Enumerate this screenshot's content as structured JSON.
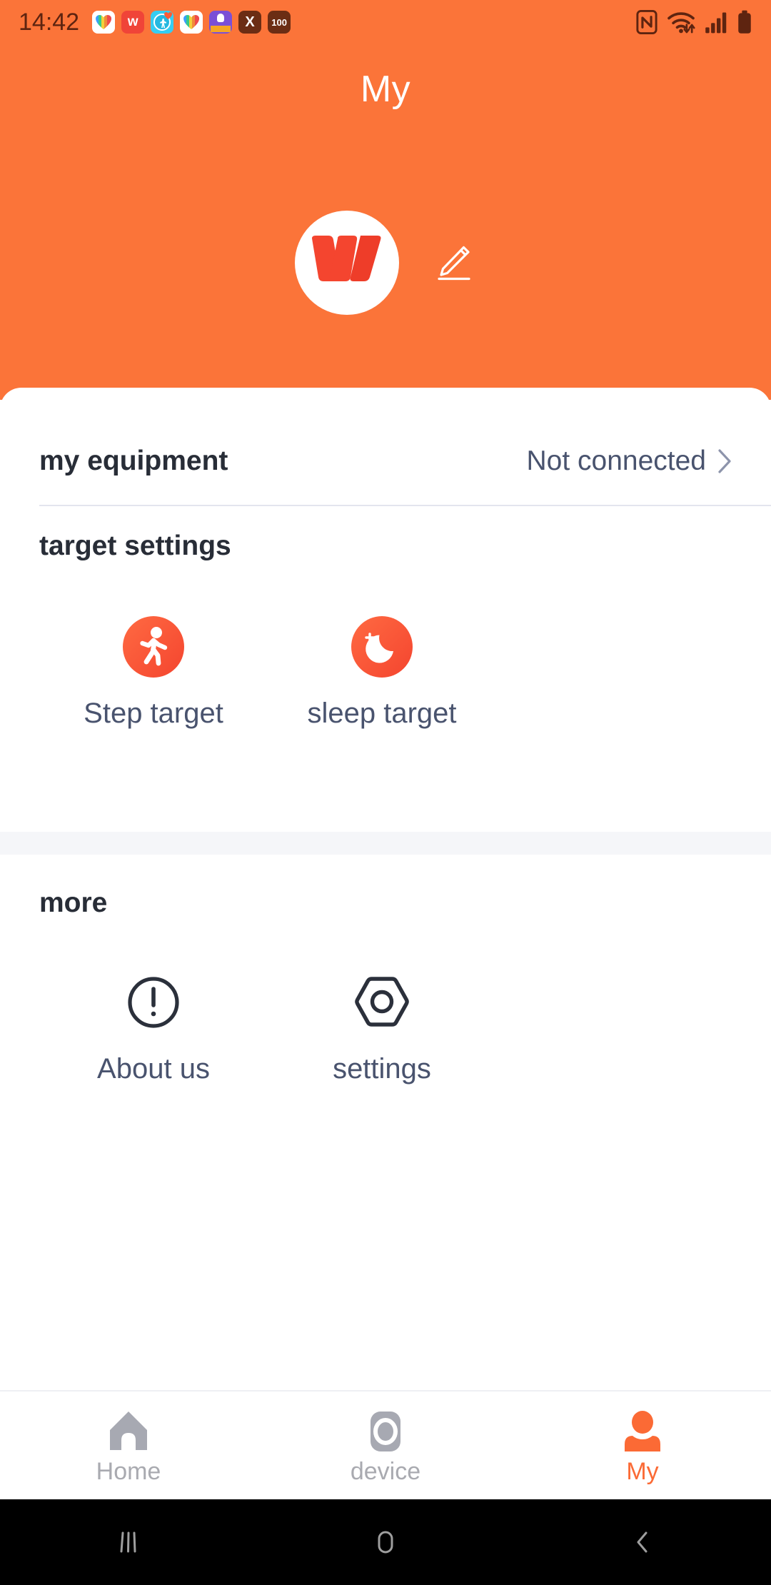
{
  "status_bar": {
    "time": "14:42",
    "app_icons": [
      {
        "name": "rainbow-heart-app-icon",
        "kind": "heart-white"
      },
      {
        "name": "w-brand-app-icon",
        "kind": "w-red",
        "letter": "w"
      },
      {
        "name": "globe-person-app-icon",
        "kind": "globe-cyan"
      },
      {
        "name": "rainbow-heart-app-icon-2",
        "kind": "heart-white"
      },
      {
        "name": "purple-badge-app-icon",
        "kind": "purple"
      },
      {
        "name": "x-app-icon",
        "kind": "x-dark",
        "letter": "X"
      },
      {
        "name": "battery-100-app-icon",
        "kind": "num-dark",
        "letter": "100"
      }
    ],
    "system_icons": [
      "nfc-icon",
      "wifi-icon",
      "cellular-signal-icon",
      "battery-icon"
    ]
  },
  "header": {
    "title": "My",
    "background_color": "#fb7439",
    "avatar": {
      "name": "user-avatar",
      "logo_letter": "W",
      "logo_color": "#f4452f"
    },
    "edit_button_label": "edit-profile"
  },
  "equipment": {
    "label": "my equipment",
    "status": "Not connected",
    "chevron": "chevron-right-icon"
  },
  "target_settings": {
    "heading": "target settings",
    "items": [
      {
        "label": "Step target",
        "icon": "walking-person-icon"
      },
      {
        "label": "sleep target",
        "icon": "moon-stars-icon"
      }
    ]
  },
  "more": {
    "heading": "more",
    "items": [
      {
        "label": "About us",
        "icon": "exclamation-circle-icon"
      },
      {
        "label": "settings",
        "icon": "hex-nut-icon"
      }
    ]
  },
  "tab_bar": {
    "tabs": [
      {
        "label": "Home",
        "icon": "home-icon",
        "active": false
      },
      {
        "label": "device",
        "icon": "device-icon",
        "active": false
      },
      {
        "label": "My",
        "icon": "person-icon",
        "active": true
      }
    ],
    "active_color": "#fb6a35",
    "inactive_color": "#a9aab0"
  },
  "android_nav": {
    "buttons": [
      "recents-icon",
      "home-circle-icon",
      "back-icon"
    ]
  },
  "colors": {
    "brand_orange": "#fb7439",
    "accent_red": "#f4452f",
    "text_dark": "#282d37",
    "text_slate": "#49536e"
  }
}
